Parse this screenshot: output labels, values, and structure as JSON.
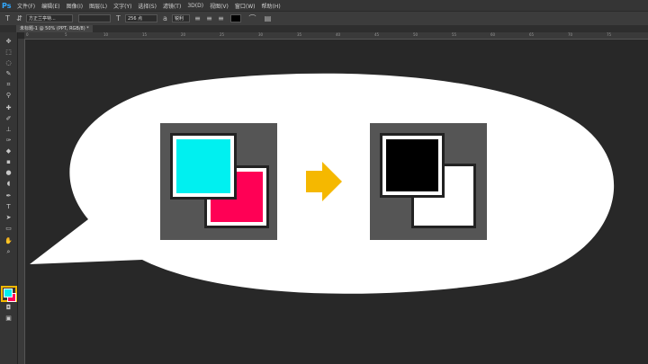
{
  "app": {
    "logo": "Ps"
  },
  "menu": [
    "文件(F)",
    "编辑(E)",
    "图像(I)",
    "图层(L)",
    "文字(Y)",
    "选择(S)",
    "滤镜(T)",
    "3D(D)",
    "视图(V)",
    "窗口(W)",
    "帮助(H)"
  ],
  "options": {
    "font_family": "方正兰亭特...",
    "font_size": "256 点",
    "antialias": "锐利"
  },
  "document": {
    "tab_label": "未标题-1 @ 50% (PPT, RGB/8) *"
  },
  "ruler": {
    "h_ticks": [
      "0",
      "5",
      "10",
      "15",
      "20",
      "25",
      "30",
      "35",
      "40",
      "45",
      "50",
      "55",
      "60",
      "65",
      "70",
      "75"
    ]
  },
  "swatches": {
    "foreground_before": "#00f0f0",
    "background_before": "#ff0055",
    "foreground_after": "#000000",
    "background_after": "#ffffff"
  },
  "colors": {
    "highlight": "#f5b800",
    "arrow": "#f5b800"
  }
}
